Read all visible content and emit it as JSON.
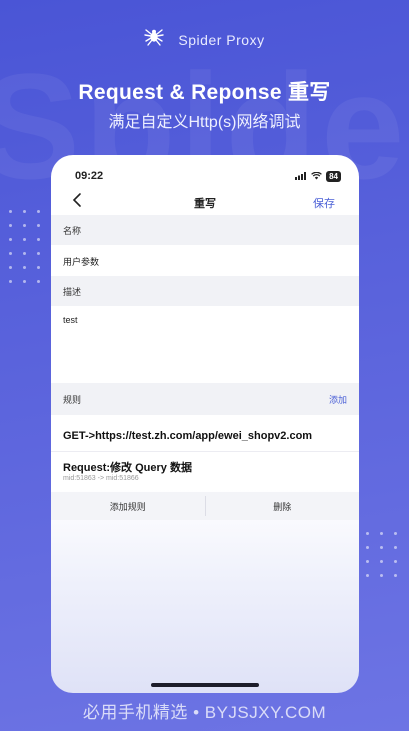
{
  "brand": {
    "name": "Spider Proxy",
    "icon": "spider-icon"
  },
  "headline": "Request & Reponse 重写",
  "subline": "满足自定义Http(s)网络调试",
  "phone": {
    "status": {
      "time": "09:22",
      "battery": "84"
    },
    "navbar": {
      "back_icon": "chevron-left-icon",
      "title": "重写",
      "save": "保存"
    },
    "name_section": {
      "label": "名称",
      "value": "用户参数"
    },
    "desc_section": {
      "label": "描述",
      "value": "test"
    },
    "rules_section": {
      "label": "规则",
      "add": "添加"
    },
    "rule": {
      "url": "GET->https://test.zh.com/app/ewei_shopv2.com",
      "request_title": "Request:修改 Query 数据",
      "request_detail": "mid:51863 -> mid:51866"
    },
    "buttons": {
      "add_rule": "添加规则",
      "delete": "删除"
    }
  },
  "footer": "必用手机精选 • BYJSJXY.COM",
  "colors": {
    "accent": "#4a5fd6",
    "background": "#5a63dc"
  }
}
